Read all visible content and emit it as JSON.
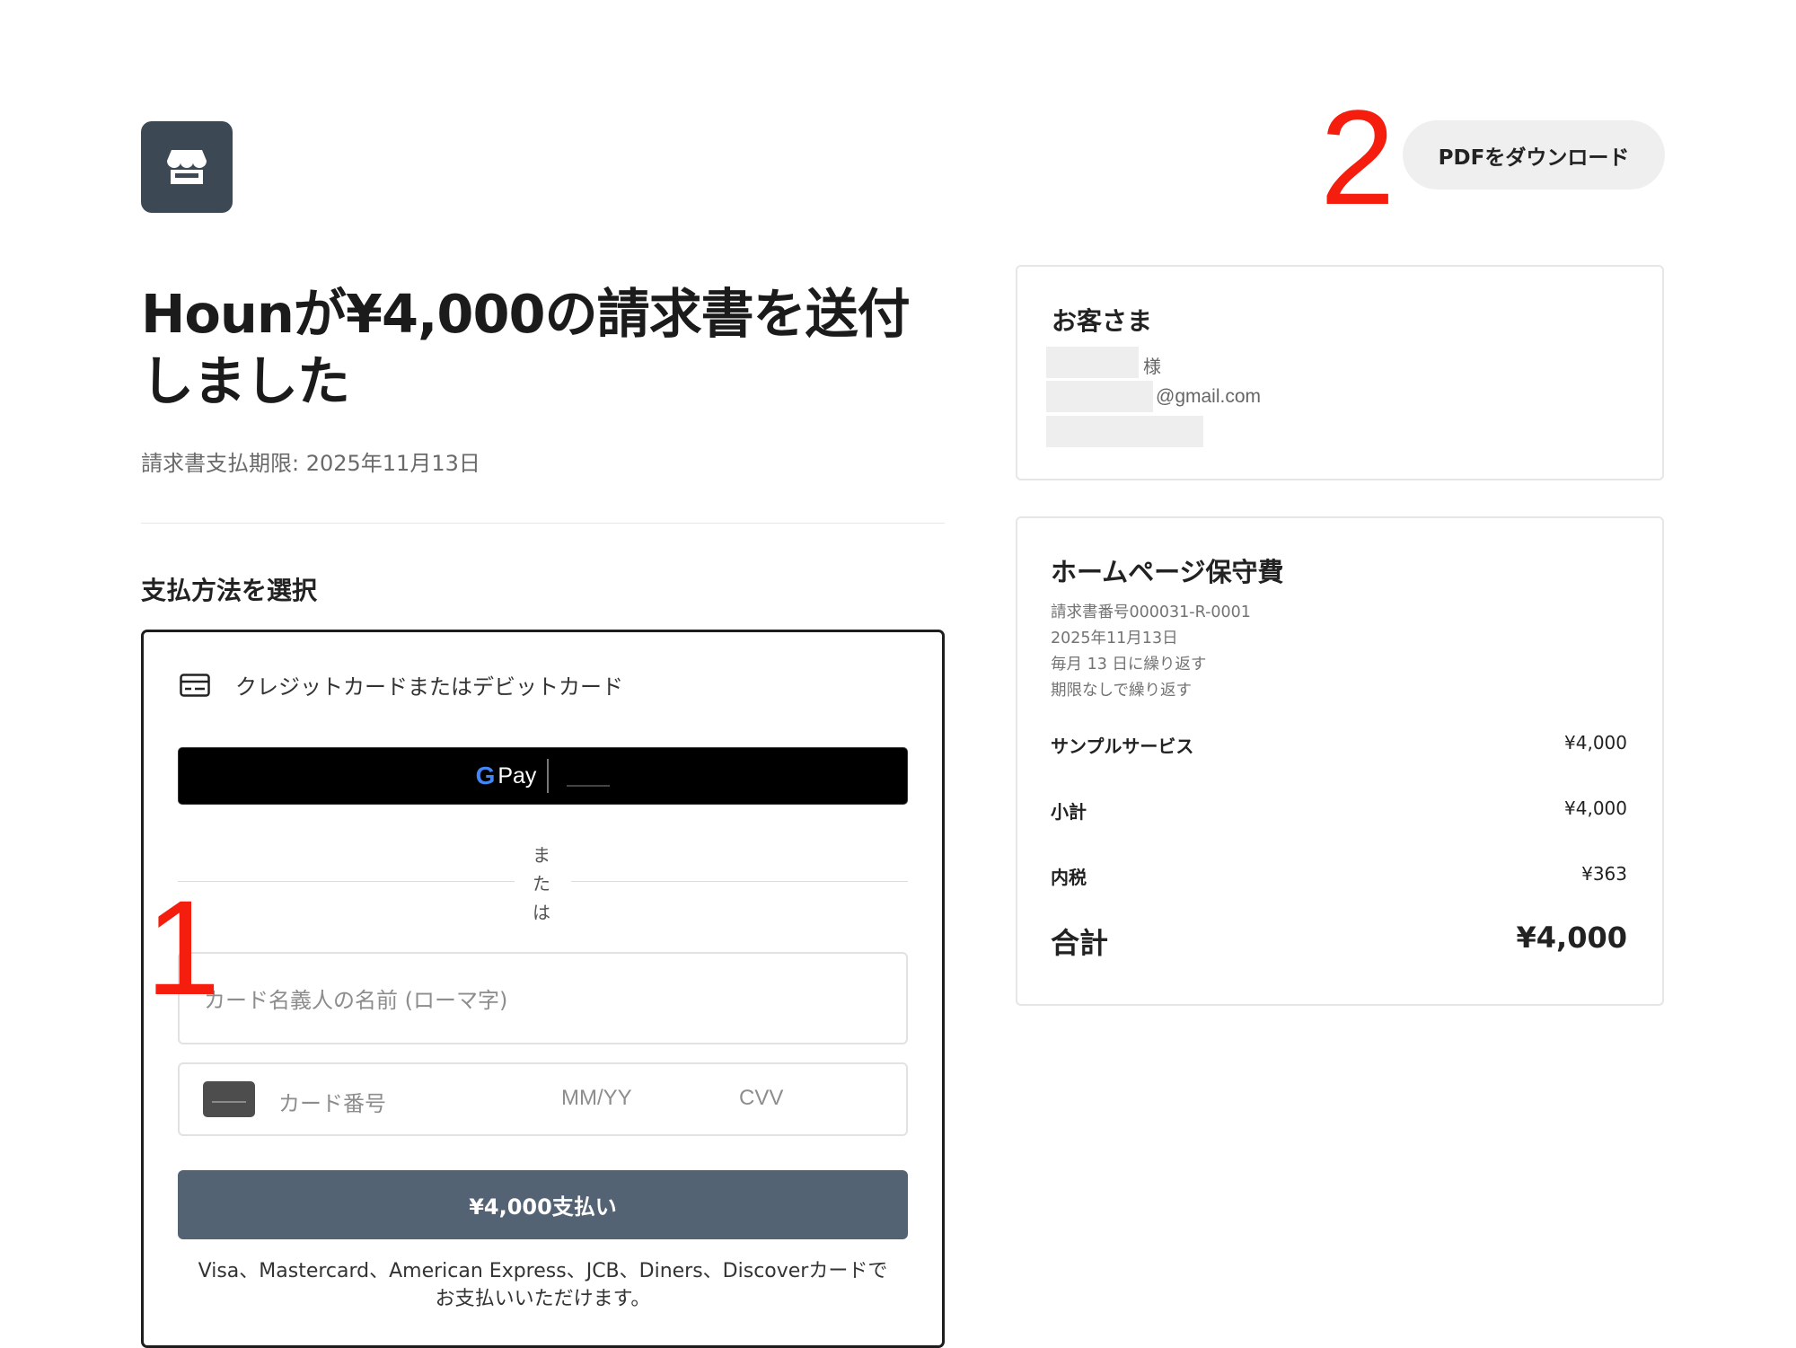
{
  "header": {
    "logo_icon": "store-icon",
    "pdf_button_label": "PDFをダウンロード",
    "annotation_1": "1",
    "annotation_2": "2"
  },
  "invoice_summary": {
    "headline": "Hounが¥4,000の請求書を送付しました",
    "due_date": "請求書支払期限: 2025年11月13日"
  },
  "payment": {
    "heading": "支払方法を選択",
    "card_option_label": "クレジットカードまたはデビットカード",
    "card_option_icon": "credit-card-icon",
    "gpay_g": "G",
    "gpay_label": "Pay",
    "or_text": [
      "ま",
      "た",
      "は"
    ],
    "cardholder_placeholder": "カード名義人の名前 (ローマ字)",
    "card_number_placeholder": "カード番号",
    "expiry_placeholder": "MM/YY",
    "cvv_placeholder": "CVV",
    "pay_button_label": "¥4,000支払い",
    "accepted_brands_line1": "Visa、Mastercard、American Express、JCB、Diners、Discoverカードで",
    "accepted_brands_line2": "お支払いいただけます。"
  },
  "customer": {
    "title": "お客さま",
    "name_suffix": "様",
    "email_suffix": "@gmail.com"
  },
  "invoice": {
    "title": "ホームページ保守費",
    "number": "請求書番号000031-R-0001",
    "date": "2025年11月13日",
    "recurrence": "毎月 13 日に繰り返す",
    "term": "期限なしで繰り返す",
    "line_item_name": "サンプルサービス",
    "line_item_amount": "¥4,000",
    "subtotal_label": "小計",
    "subtotal_amount": "¥4,000",
    "tax_label": "内税",
    "tax_amount": "¥363",
    "total_label": "合計",
    "total_amount": "¥4,000"
  },
  "colors": {
    "logo_bg": "#3d4855",
    "pay_button_bg": "#546374",
    "annotation_red": "#f51d0d"
  }
}
